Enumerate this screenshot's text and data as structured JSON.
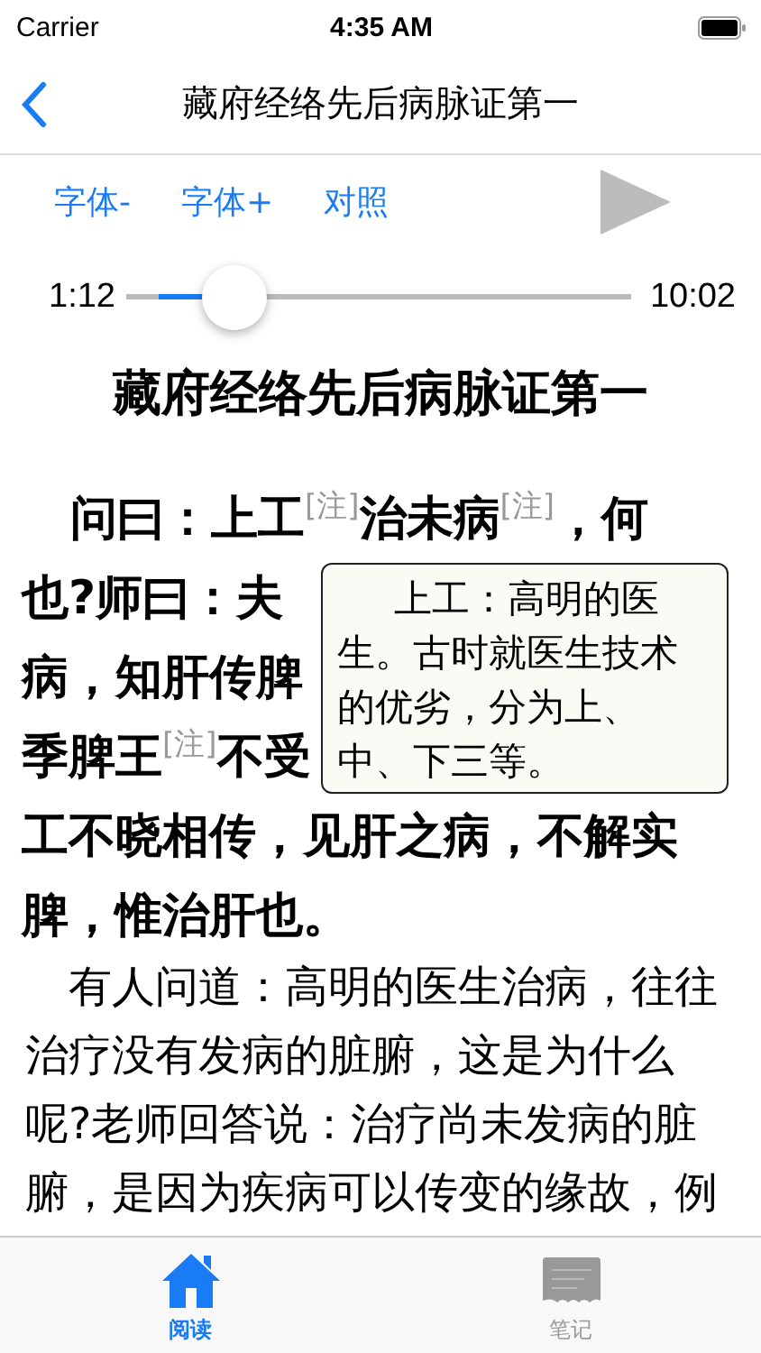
{
  "status_bar": {
    "carrier": "Carrier",
    "time": "4:35 AM"
  },
  "nav": {
    "title": "藏府经络先后病脉证第一"
  },
  "toolbar": {
    "buttons": [
      "字体-",
      "字体+",
      "对照"
    ]
  },
  "player": {
    "elapsed": "1:12",
    "duration": "10:02",
    "level": 0.17
  },
  "heading": "藏府经络先后病脉证第一",
  "original_lines": [
    [
      {
        "kind": "text",
        "text": "问曰：上工"
      },
      {
        "kind": "note",
        "text": "[注]"
      },
      {
        "kind": "text",
        "text": "治未病"
      },
      {
        "kind": "note",
        "text": "[注]"
      },
      {
        "kind": "text",
        "text": "，何"
      }
    ],
    [
      {
        "kind": "text",
        "text": "也?师曰：夫"
      }
    ],
    [
      {
        "kind": "text",
        "text": "病，知肝传脾"
      }
    ],
    [
      {
        "kind": "text",
        "text": "季脾王"
      },
      {
        "kind": "note",
        "text": "[注]"
      },
      {
        "kind": "text",
        "text": "不受"
      }
    ],
    [
      {
        "kind": "text",
        "text": "工不晓相传，见肝之病，不解实"
      }
    ],
    [
      {
        "kind": "text",
        "text": "脾，惟治肝也。"
      }
    ]
  ],
  "note_popup": {
    "text": "上工：高明的医生。古时就医生技术的优劣，分为上、中、下三等。"
  },
  "translation": "有人问道：高明的医生治病，往往治疗没有发病的脏腑，这是为什么呢?老师回答说：治疗尚未发病的脏腑，是因为疾病可以传变的缘故，例",
  "tabs": [
    {
      "label": "阅读",
      "kind": "read",
      "selected": true
    },
    {
      "label": "笔记",
      "kind": "notes",
      "selected": false
    }
  ]
}
